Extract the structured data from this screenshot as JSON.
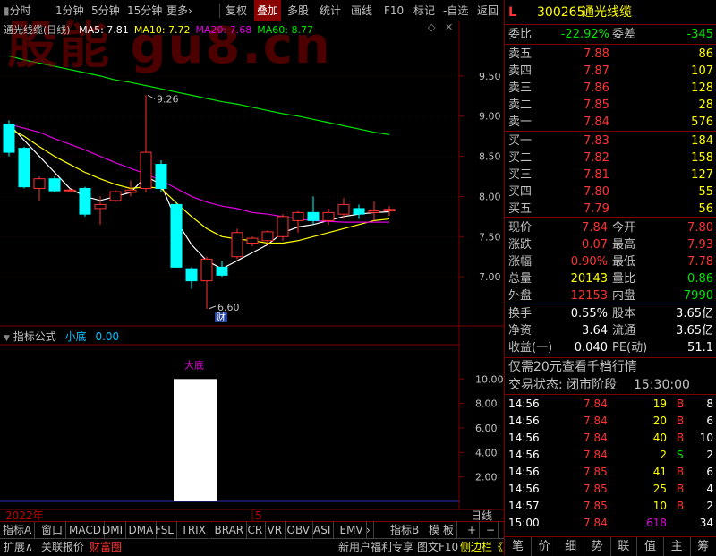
{
  "toolbar": {
    "items": [
      "分时",
      "1分钟",
      "5分钟",
      "15分钟",
      "更多",
      "复权",
      "叠加",
      "多股",
      "统计",
      "画线",
      "F10",
      "标记",
      "-自选",
      "返回"
    ],
    "more_arrow": "›",
    "active_index": 6
  },
  "watermark": "股能 gu8.cn",
  "chart_title": "通光线缆(日线)",
  "ma_legend": [
    {
      "label": "MA5: 7.81",
      "color": "#ffffff"
    },
    {
      "label": "MA10: 7.72",
      "color": "#ffff00"
    },
    {
      "label": "MA20: 7.68",
      "color": "#e000e0"
    },
    {
      "label": "MA60: 8.77",
      "color": "#00e600"
    }
  ],
  "colors": {
    "up": "#ff3232",
    "down": "#00ffff",
    "ma5": "#ffffff",
    "ma10": "#ffff00",
    "ma20": "#e000e0",
    "ma60": "#00e600",
    "grid": "#800000",
    "axis_text": "#c0c0c0"
  },
  "chart_data": [
    {
      "type": "candlestick",
      "title": "通光线缆(日线)",
      "ylim": [
        6.5,
        10.0
      ],
      "y_ticks": [
        "9.50",
        "9.00",
        "8.50",
        "8.00",
        "7.50",
        "7.00"
      ],
      "y_tick_values": [
        9.5,
        9.0,
        8.5,
        8.0,
        7.5,
        7.0
      ],
      "candles": [
        {
          "o": 8.9,
          "h": 8.95,
          "l": 8.5,
          "c": 8.55
        },
        {
          "o": 8.6,
          "h": 8.62,
          "l": 8.1,
          "c": 8.12
        },
        {
          "o": 8.1,
          "h": 8.25,
          "l": 7.95,
          "c": 8.22
        },
        {
          "o": 8.22,
          "h": 8.25,
          "l": 8.05,
          "c": 8.07
        },
        {
          "o": 8.07,
          "h": 8.1,
          "l": 8.07,
          "c": 8.08
        },
        {
          "o": 8.1,
          "h": 8.12,
          "l": 7.75,
          "c": 7.78
        },
        {
          "o": 7.85,
          "h": 8.0,
          "l": 7.65,
          "c": 7.9
        },
        {
          "o": 7.95,
          "h": 8.08,
          "l": 7.93,
          "c": 8.06
        },
        {
          "o": 8.05,
          "h": 8.2,
          "l": 8.0,
          "c": 8.08
        },
        {
          "o": 8.1,
          "h": 9.26,
          "l": 8.05,
          "c": 8.55
        },
        {
          "o": 8.4,
          "h": 8.45,
          "l": 8.05,
          "c": 8.1
        },
        {
          "o": 7.9,
          "h": 7.92,
          "l": 7.15,
          "c": 7.12
        },
        {
          "o": 7.1,
          "h": 7.12,
          "l": 6.85,
          "c": 6.95
        },
        {
          "o": 6.95,
          "h": 7.25,
          "l": 6.6,
          "c": 7.22
        },
        {
          "o": 7.12,
          "h": 7.2,
          "l": 7.0,
          "c": 7.02
        },
        {
          "o": 7.25,
          "h": 7.6,
          "l": 7.22,
          "c": 7.55
        },
        {
          "o": 7.42,
          "h": 7.5,
          "l": 7.38,
          "c": 7.48
        },
        {
          "o": 7.45,
          "h": 7.58,
          "l": 7.4,
          "c": 7.56
        },
        {
          "o": 7.5,
          "h": 7.78,
          "l": 7.45,
          "c": 7.75
        },
        {
          "o": 7.7,
          "h": 7.82,
          "l": 7.55,
          "c": 7.8
        },
        {
          "o": 7.8,
          "h": 8.0,
          "l": 7.65,
          "c": 7.7
        },
        {
          "o": 7.7,
          "h": 7.85,
          "l": 7.65,
          "c": 7.8
        },
        {
          "o": 7.78,
          "h": 7.98,
          "l": 7.72,
          "c": 7.9
        },
        {
          "o": 7.85,
          "h": 7.9,
          "l": 7.72,
          "c": 7.78
        },
        {
          "o": 7.8,
          "h": 7.94,
          "l": 7.7,
          "c": 7.82
        },
        {
          "o": 7.82,
          "h": 7.88,
          "l": 7.76,
          "c": 7.84
        }
      ],
      "series": [
        {
          "name": "MA5",
          "values": [
            8.9,
            8.7,
            8.5,
            8.3,
            8.1,
            8.0,
            7.95,
            8.0,
            8.05,
            8.25,
            8.15,
            7.7,
            7.4,
            7.2,
            7.1,
            7.2,
            7.3,
            7.4,
            7.55,
            7.62,
            7.65,
            7.7,
            7.75,
            7.78,
            7.8,
            7.81
          ]
        },
        {
          "name": "MA10",
          "values": [
            8.85,
            8.75,
            8.62,
            8.5,
            8.4,
            8.3,
            8.22,
            8.15,
            8.1,
            8.12,
            8.1,
            7.92,
            7.75,
            7.6,
            7.5,
            7.47,
            7.45,
            7.42,
            7.42,
            7.45,
            7.5,
            7.55,
            7.6,
            7.65,
            7.7,
            7.72
          ]
        },
        {
          "name": "MA20",
          "values": [
            8.9,
            8.85,
            8.8,
            8.72,
            8.65,
            8.58,
            8.5,
            8.42,
            8.35,
            8.28,
            8.2,
            8.1,
            8.0,
            7.93,
            7.88,
            7.85,
            7.8,
            7.78,
            7.75,
            7.72,
            7.7,
            7.69,
            7.68,
            7.68,
            7.68,
            7.68
          ]
        },
        {
          "name": "MA60",
          "values": [
            9.75,
            9.7,
            9.66,
            9.62,
            9.58,
            9.54,
            9.5,
            9.45,
            9.42,
            9.38,
            9.34,
            9.3,
            9.26,
            9.22,
            9.18,
            9.15,
            9.11,
            9.07,
            9.03,
            9.0,
            8.96,
            8.92,
            8.88,
            8.84,
            8.8,
            8.77
          ]
        }
      ],
      "annotations": [
        {
          "text": "9.26",
          "candle": 9
        },
        {
          "text": "6.60",
          "candle": 13
        },
        {
          "text": "财",
          "candle": 14
        }
      ]
    },
    {
      "type": "bar",
      "title": "指标公式",
      "series_label": "小底",
      "series_value": "0.00",
      "top_label": "大底",
      "ylim": [
        0,
        12.0
      ],
      "y_ticks": [
        "10.00",
        "8.00",
        "6.00",
        "4.00",
        "2.00"
      ],
      "y_tick_values": [
        10,
        8,
        6,
        4,
        2
      ],
      "bars": [
        {
          "candle": 11,
          "span": 3,
          "value": 10.0
        }
      ]
    }
  ],
  "xaxis": {
    "year_label": "2022年",
    "month_label": "5",
    "period_label": "日线"
  },
  "tabs": [
    "指标A",
    "窗口",
    "MACD",
    "DMI",
    "DMA",
    "FSL",
    "TRIX",
    "BRAR",
    "CR",
    "VR",
    "OBV",
    "ASI",
    "EMV",
    "›",
    "指标B",
    "模 板",
    "+",
    "−"
  ],
  "status_bar": {
    "left": "扩展∧",
    "report": "关联报价",
    "fortune": "财富圈",
    "promo": "新用户福利专享",
    "f10": "图文F10",
    "sidebar": "侧边栏《"
  },
  "quote": {
    "flag": "L",
    "code": "300265",
    "name": "通光线缆",
    "weibi_label": "委比",
    "weibi": "-22.92%",
    "weicha_label": "委差",
    "weicha": "-345",
    "asks": [
      {
        "label": "卖五",
        "price": "7.88",
        "vol": "86"
      },
      {
        "label": "卖四",
        "price": "7.87",
        "vol": "107"
      },
      {
        "label": "卖三",
        "price": "7.86",
        "vol": "128"
      },
      {
        "label": "卖二",
        "price": "7.85",
        "vol": "28"
      },
      {
        "label": "卖一",
        "price": "7.84",
        "vol": "576"
      }
    ],
    "bids": [
      {
        "label": "买一",
        "price": "7.83",
        "vol": "184"
      },
      {
        "label": "买二",
        "price": "7.82",
        "vol": "158"
      },
      {
        "label": "买三",
        "price": "7.81",
        "vol": "127"
      },
      {
        "label": "买四",
        "price": "7.80",
        "vol": "55"
      },
      {
        "label": "买五",
        "price": "7.79",
        "vol": "56"
      }
    ],
    "stats": [
      {
        "l1": "现价",
        "v1": "7.84",
        "c1": "red",
        "l2": "今开",
        "v2": "7.80",
        "c2": "red"
      },
      {
        "l1": "涨跌",
        "v1": "0.07",
        "c1": "red",
        "l2": "最高",
        "v2": "7.93",
        "c2": "red"
      },
      {
        "l1": "涨幅",
        "v1": "0.90%",
        "c1": "red",
        "l2": "最低",
        "v2": "7.78",
        "c2": "red"
      },
      {
        "l1": "总量",
        "v1": "20143",
        "c1": "yellow",
        "l2": "量比",
        "v2": "0.86",
        "c2": "green"
      },
      {
        "l1": "外盘",
        "v1": "12153",
        "c1": "red",
        "l2": "内盘",
        "v2": "7990",
        "c2": "green"
      }
    ],
    "stats2": [
      {
        "l1": "换手",
        "v1": "0.55%",
        "l2": "股本",
        "v2": "3.65亿"
      },
      {
        "l1": "净资",
        "v1": "3.64",
        "l2": "流通",
        "v2": "3.65亿"
      },
      {
        "l1": "收益(一)",
        "v1": "0.040",
        "l2": "PE(动)",
        "v2": "51.1"
      }
    ],
    "promo": "仅需20元查看千档行情",
    "trade_status_label": "交易状态: 闭市阶段",
    "trade_time": "15:30:00",
    "ticks": [
      {
        "t": "14:56",
        "p": "7.84",
        "v": "19",
        "s": "B",
        "n": "8"
      },
      {
        "t": "14:56",
        "p": "7.84",
        "v": "20",
        "s": "B",
        "n": "6"
      },
      {
        "t": "14:56",
        "p": "7.84",
        "v": "40",
        "s": "B",
        "n": "10"
      },
      {
        "t": "14:56",
        "p": "7.84",
        "v": "2",
        "s": "S",
        "n": "2"
      },
      {
        "t": "14:56",
        "p": "7.85",
        "v": "41",
        "s": "B",
        "n": "6"
      },
      {
        "t": "14:56",
        "p": "7.85",
        "v": "25",
        "s": "B",
        "n": "4"
      },
      {
        "t": "14:57",
        "p": "7.85",
        "v": "10",
        "s": "B",
        "n": "2"
      },
      {
        "t": "15:00",
        "p": "7.84",
        "v": "618",
        "s": "",
        "n": "34"
      }
    ],
    "bottom_tabs": [
      "笔",
      "价",
      "细",
      "势",
      "联",
      "值",
      "主",
      "筹"
    ]
  }
}
